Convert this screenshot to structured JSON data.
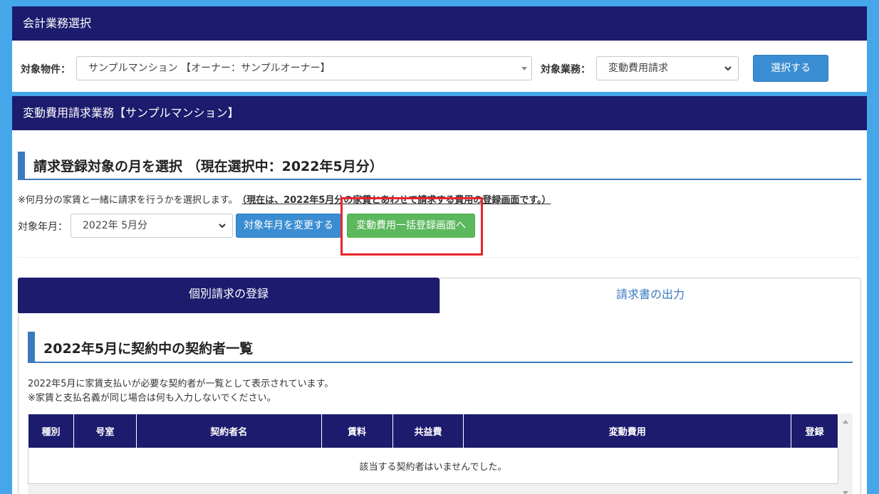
{
  "panel1": {
    "header": "会計業務選択",
    "property_label": "対象物件：",
    "property_value": "サンプルマンション 【オーナー：サンプルオーナー】",
    "task_label": "対象業務：",
    "task_value": "変動費用請求",
    "select_button": "選択する"
  },
  "panel2": {
    "header": "変動費用請求業務【サンプルマンション】",
    "section_title": "請求登録対象の月を選択 （現在選択中：2022年5月分）",
    "note": "※何月分の家賃と一緒に請求を行うかを選択します。",
    "note_emphasis": "（現在は、2022年5月分の家賃とあわせて請求する費用の登録画面です。）",
    "month_label": "対象年月：",
    "month_value": "2022年 5月分",
    "change_month_button": "対象年月を変更する",
    "bulk_register_button": "変動費用一括登録画面へ",
    "tabs": [
      {
        "label": "個別請求の登録",
        "active": true
      },
      {
        "label": "請求書の出力",
        "active": false
      }
    ],
    "list_title": "2022年5月に契約中の契約者一覧",
    "list_desc1": "2022年5月に家賃支払いが必要な契約者が一覧として表示されています。",
    "list_desc2": "※家賃と支払名義が同じ場合は何も入力しないでください。",
    "table": {
      "headers": [
        "種別",
        "号室",
        "契約者名",
        "賃料",
        "共益費",
        "変動費用",
        "登録"
      ],
      "empty_message": "該当する契約者はいませんでした。"
    }
  },
  "colors": {
    "page_bg": "#45a6ea",
    "header_bg": "#1c1b6e",
    "primary_button": "#3a8dd2",
    "success_button": "#5cb85c",
    "highlight": "#e8252b",
    "accent_line": "#3a7bbf"
  },
  "icons": [
    "caret-down-icon",
    "chevron-down-icon",
    "scroll-up-icon",
    "scroll-down-icon"
  ]
}
